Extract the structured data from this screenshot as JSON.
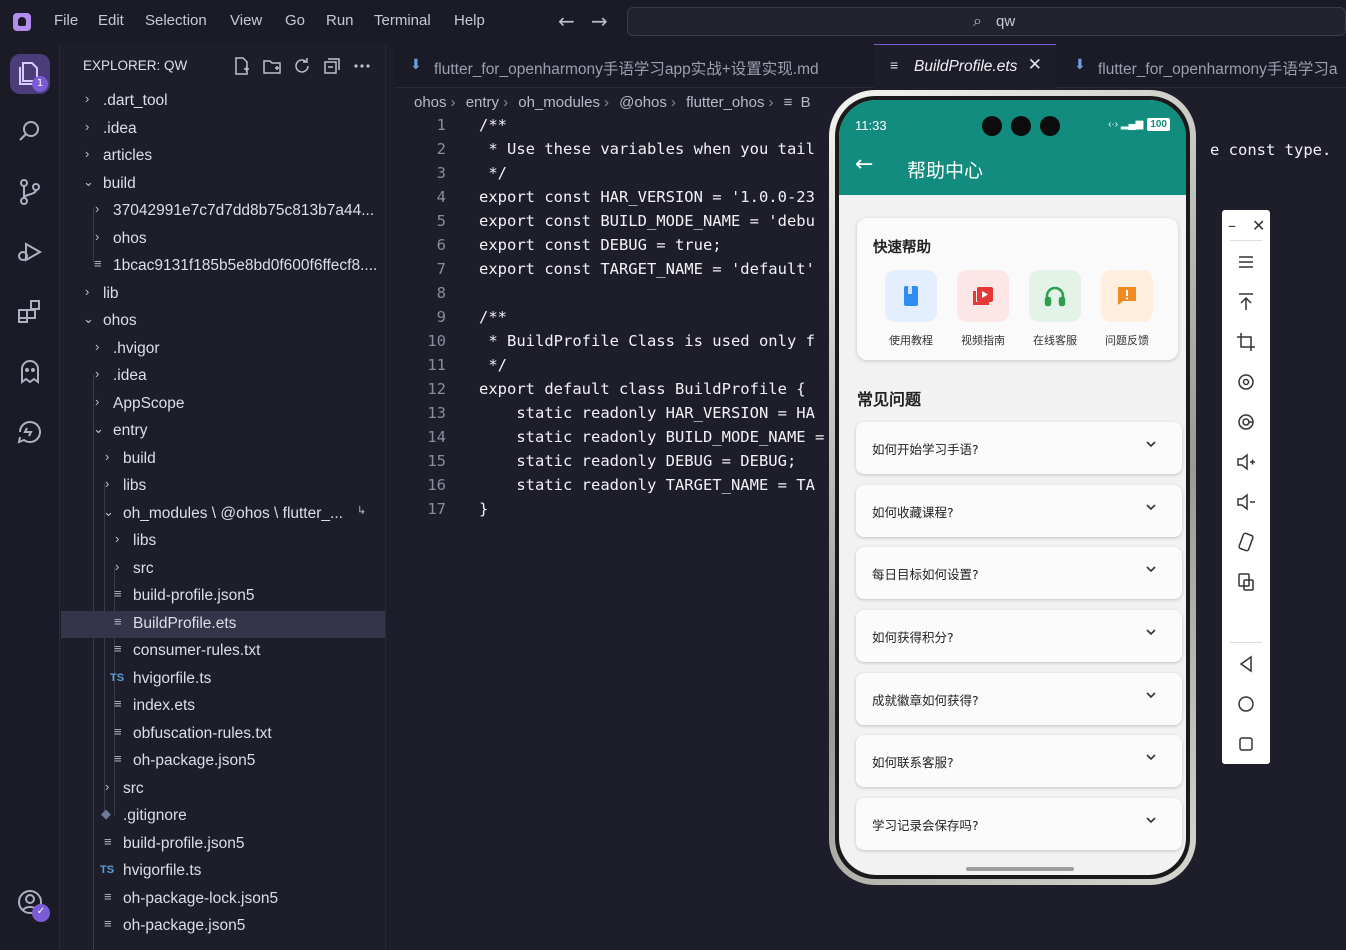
{
  "menubar": {
    "items": [
      "File",
      "Edit",
      "Selection",
      "View",
      "Go",
      "Run",
      "Terminal",
      "Help"
    ],
    "search_text": "qw"
  },
  "activity_bar": {
    "explorer_badge": "1"
  },
  "sidebar": {
    "title": "EXPLORER: QW",
    "tree": [
      {
        "label": ".dart_tool"
      },
      {
        "label": ".idea"
      },
      {
        "label": "articles"
      },
      {
        "label": "build"
      },
      {
        "label": "37042991e7c7d7dd8b75c813b7a44..."
      },
      {
        "label": "ohos"
      },
      {
        "label": "1bcac9131f185b5e8bd0f600f6ffecf8...."
      },
      {
        "label": "lib"
      },
      {
        "label": "ohos"
      },
      {
        "label": ".hvigor"
      },
      {
        "label": ".idea"
      },
      {
        "label": "AppScope"
      },
      {
        "label": "entry"
      },
      {
        "label": "build"
      },
      {
        "label": "libs"
      },
      {
        "label": "oh_modules \\ @ohos \\ flutter_..."
      },
      {
        "label": "libs"
      },
      {
        "label": "src"
      },
      {
        "label": "build-profile.json5"
      },
      {
        "label": "BuildProfile.ets"
      },
      {
        "label": "consumer-rules.txt"
      },
      {
        "label": "hvigorfile.ts"
      },
      {
        "label": "index.ets"
      },
      {
        "label": "obfuscation-rules.txt"
      },
      {
        "label": "oh-package.json5"
      },
      {
        "label": "src"
      },
      {
        "label": ".gitignore"
      },
      {
        "label": "build-profile.json5"
      },
      {
        "label": "hvigorfile.ts"
      },
      {
        "label": "oh-package-lock.json5"
      },
      {
        "label": "oh-package.json5"
      }
    ]
  },
  "editor": {
    "tabs": [
      {
        "label": "flutter_for_openharmony手语学习app实战+设置实现.md"
      },
      {
        "label": "BuildProfile.ets"
      },
      {
        "label": "flutter_for_openharmony手语学习a"
      }
    ],
    "breadcrumb": [
      "ohos",
      "entry",
      "oh_modules",
      "@ohos",
      "flutter_ohos",
      "B"
    ],
    "code_lines": [
      {
        "n": "1",
        "text": "/**"
      },
      {
        "n": "2",
        "text": " * Use these variables when you tail"
      },
      {
        "n": "3",
        "text": " */"
      },
      {
        "n": "4",
        "text": "export const HAR_VERSION = '1.0.0-23"
      },
      {
        "n": "5",
        "text": "export const BUILD_MODE_NAME = 'debu"
      },
      {
        "n": "6",
        "text": "export const DEBUG = true;"
      },
      {
        "n": "7",
        "text": "export const TARGET_NAME = 'default'"
      },
      {
        "n": "8",
        "text": ""
      },
      {
        "n": "9",
        "text": "/**"
      },
      {
        "n": "10",
        "text": " * BuildProfile Class is used only f"
      },
      {
        "n": "11",
        "text": " */"
      },
      {
        "n": "12",
        "text": "export default class BuildProfile {"
      },
      {
        "n": "13",
        "text": "    static readonly HAR_VERSION = HA"
      },
      {
        "n": "14",
        "text": "    static readonly BUILD_MODE_NAME ="
      },
      {
        "n": "15",
        "text": "    static readonly DEBUG = DEBUG;"
      },
      {
        "n": "16",
        "text": "    static readonly TARGET_NAME = TA"
      },
      {
        "n": "17",
        "text": "}"
      }
    ],
    "line2_tail": "e const type."
  },
  "phone": {
    "status_time": "11:33",
    "battery": "100",
    "title": "帮助中心",
    "quick_help_title": "快速帮助",
    "quick_items": [
      {
        "label": "使用教程",
        "color": "#e3efff",
        "icon_color": "#2f8cf0"
      },
      {
        "label": "视频指南",
        "color": "#fde6e6",
        "icon_color": "#e53935"
      },
      {
        "label": "在线客服",
        "color": "#e3f3e8",
        "icon_color": "#2e9e4f"
      },
      {
        "label": "问题反馈",
        "color": "#fdeede",
        "icon_color": "#f08a24"
      }
    ],
    "faq_title": "常见问题",
    "faqs": [
      "如何开始学习手语?",
      "如何收藏课程?",
      "每日目标如何设置?",
      "如何获得积分?",
      "成就徽章如何获得?",
      "如何联系客服?",
      "学习记录会保存吗?"
    ],
    "accent": "#128c7e"
  }
}
